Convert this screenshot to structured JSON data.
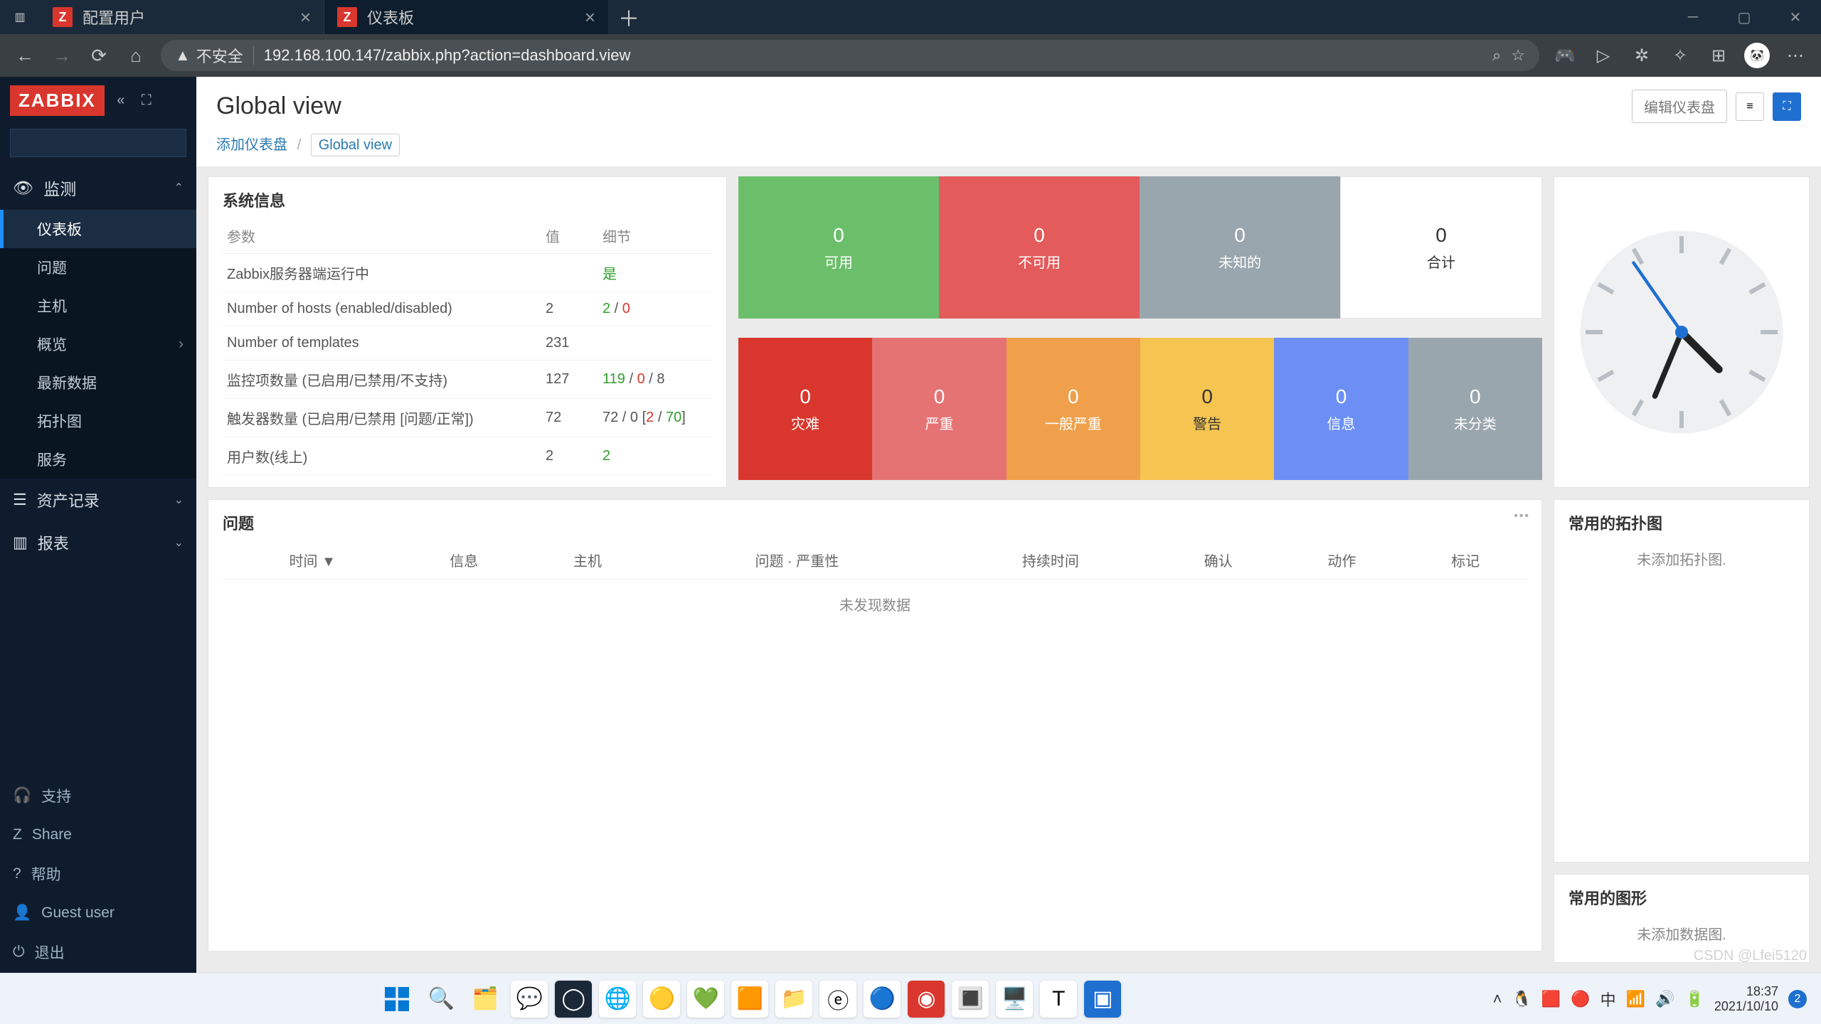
{
  "browser": {
    "tabs": [
      {
        "title": "配置用户",
        "active": false
      },
      {
        "title": "仪表板",
        "active": true
      }
    ],
    "insecure_label": "不安全",
    "url": "192.168.100.147/zabbix.php?action=dashboard.view"
  },
  "sidebar": {
    "logo": "ZABBIX",
    "sections": [
      {
        "icon": "eye",
        "label": "监测",
        "expanded": true,
        "items": [
          {
            "label": "仪表板",
            "active": true
          },
          {
            "label": "问题"
          },
          {
            "label": "主机"
          },
          {
            "label": "概览",
            "chev": true
          },
          {
            "label": "最新数据"
          },
          {
            "label": "拓扑图"
          },
          {
            "label": "服务"
          }
        ]
      },
      {
        "icon": "list",
        "label": "资产记录",
        "chev": true
      },
      {
        "icon": "bar",
        "label": "报表",
        "chev": true
      }
    ],
    "bottom": [
      {
        "icon": "headset",
        "label": "支持"
      },
      {
        "icon": "z",
        "label": "Share"
      },
      {
        "icon": "q",
        "label": "帮助"
      },
      {
        "icon": "user",
        "label": "Guest user"
      },
      {
        "icon": "power",
        "label": "退出"
      }
    ]
  },
  "header": {
    "title": "Global view",
    "edit_btn": "编辑仪表盘"
  },
  "breadcrumb": {
    "root": "添加仪表盘",
    "current": "Global view"
  },
  "sysinfo": {
    "title": "系统信息",
    "cols": {
      "param": "参数",
      "value": "值",
      "detail": "细节"
    },
    "rows": [
      {
        "p": "Zabbix服务器端运行中",
        "v": "",
        "d": [
          {
            "t": "是",
            "c": "g"
          }
        ]
      },
      {
        "p": "Number of hosts (enabled/disabled)",
        "v": "2",
        "d": [
          {
            "t": "2",
            "c": "g"
          },
          {
            "t": " / "
          },
          {
            "t": "0",
            "c": "r"
          }
        ]
      },
      {
        "p": "Number of templates",
        "v": "231",
        "d": []
      },
      {
        "p": "监控项数量  (已启用/已禁用/不支持)",
        "v": "127",
        "d": [
          {
            "t": "119",
            "c": "g"
          },
          {
            "t": " / "
          },
          {
            "t": "0",
            "c": "r"
          },
          {
            "t": " / "
          },
          {
            "t": "8",
            "c": ""
          }
        ]
      },
      {
        "p": "触发器数量  (已启用/已禁用 [问题/正常])",
        "v": "72",
        "d": [
          {
            "t": "72 / 0 ["
          },
          {
            "t": "2",
            "c": "r"
          },
          {
            "t": " / "
          },
          {
            "t": "70",
            "c": "g"
          },
          {
            "t": "]"
          }
        ]
      },
      {
        "p": "用户数(线上)",
        "v": "2",
        "d": [
          {
            "t": "2",
            "c": "g"
          }
        ]
      }
    ]
  },
  "host_tiles": [
    {
      "n": "0",
      "l": "可用",
      "c": "t-green"
    },
    {
      "n": "0",
      "l": "不可用",
      "c": "t-red"
    },
    {
      "n": "0",
      "l": "未知的",
      "c": "t-grey"
    },
    {
      "n": "0",
      "l": "合计",
      "c": "t-white"
    }
  ],
  "sev_tiles": [
    {
      "n": "0",
      "l": "灾难",
      "c": "s0"
    },
    {
      "n": "0",
      "l": "严重",
      "c": "s1"
    },
    {
      "n": "0",
      "l": "一般严重",
      "c": "s2"
    },
    {
      "n": "0",
      "l": "警告",
      "c": "s3"
    },
    {
      "n": "0",
      "l": "信息",
      "c": "s4"
    },
    {
      "n": "0",
      "l": "未分类",
      "c": "s5"
    }
  ],
  "problems": {
    "title": "问题",
    "cols": [
      "时间 ▼",
      "信息",
      "主机",
      "问题 · 严重性",
      "持续时间",
      "确认",
      "动作",
      "标记"
    ],
    "empty": "未发现数据"
  },
  "maps": {
    "title": "常用的拓扑图",
    "empty": "未添加拓扑图."
  },
  "graphs": {
    "title": "常用的图形",
    "empty": "未添加数据图."
  },
  "taskbar": {
    "tray_time": "18:37",
    "tray_date": "2021/10/10",
    "ime": "中",
    "notif_count": "2"
  },
  "watermark": "CSDN @Lfei5120"
}
